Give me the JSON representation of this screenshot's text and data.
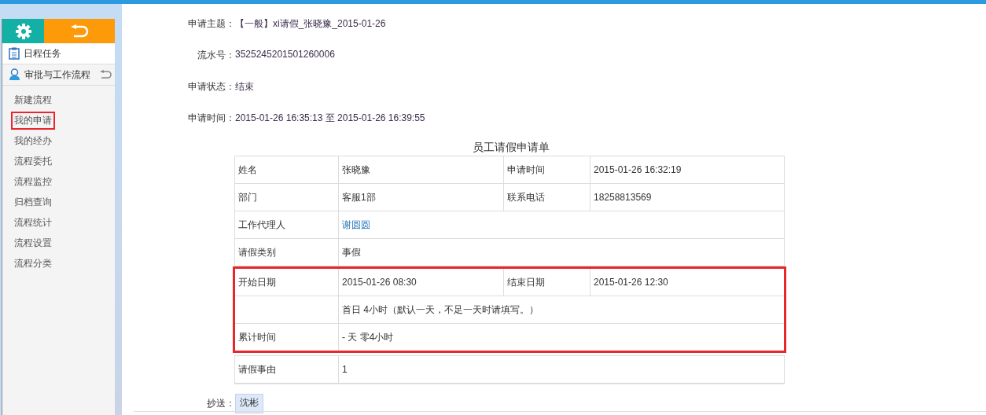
{
  "sidebar": {
    "menus": [
      {
        "label": "日程任务",
        "kind": "calendar"
      },
      {
        "label": "审批与工作流程",
        "kind": "workflow"
      }
    ],
    "items": [
      {
        "label": "新建流程",
        "selected": false
      },
      {
        "label": "我的申请",
        "selected": true
      },
      {
        "label": "我的经办",
        "selected": false
      },
      {
        "label": "流程委托",
        "selected": false
      },
      {
        "label": "流程监控",
        "selected": false
      },
      {
        "label": "归档查询",
        "selected": false
      },
      {
        "label": "流程统计",
        "selected": false
      },
      {
        "label": "流程设置",
        "selected": false
      },
      {
        "label": "流程分类",
        "selected": false
      }
    ]
  },
  "fields": [
    {
      "label": "申请主题：",
      "value": "【一般】xi请假_张晓豫_2015-01-26"
    },
    {
      "label": "流水号：",
      "value": "3525245201501260006"
    },
    {
      "label": "申请状态：",
      "value": "结束"
    },
    {
      "label": "申请时间：",
      "value": "2015-01-26 16:35:13 至 2015-01-26 16:39:55"
    }
  ],
  "form": {
    "title": "员工请假申请单",
    "sections": [
      {
        "highlighted": false,
        "rows": [
          {
            "cells": [
              {
                "text": "姓名"
              },
              {
                "text": "张晓豫"
              },
              {
                "text": "申请时间"
              },
              {
                "text": "2015-01-26 16:32:19"
              }
            ]
          },
          {
            "cells": [
              {
                "text": "部门"
              },
              {
                "text": "客服1部"
              },
              {
                "text": "联系电话"
              },
              {
                "text": "18258813569"
              }
            ]
          },
          {
            "cells": [
              {
                "text": "工作代理人"
              },
              {
                "text": "谢圆圆",
                "kind": "link"
              }
            ]
          },
          {
            "cells": [
              {
                "text": "请假类别"
              },
              {
                "text": "事假"
              }
            ]
          }
        ]
      },
      {
        "highlighted": true,
        "rows": [
          {
            "cells": [
              {
                "text": "开始日期"
              },
              {
                "text": "2015-01-26 08:30"
              },
              {
                "text": "结束日期"
              },
              {
                "text": "2015-01-26 12:30"
              }
            ]
          },
          {
            "cells": [
              {
                "text": ""
              },
              {
                "text": "首日 4小时（默认一天，不足一天时请填写。）"
              }
            ]
          },
          {
            "cells": [
              {
                "text": "累计时间"
              },
              {
                "text": "- 天 零4小时"
              }
            ]
          }
        ]
      },
      {
        "highlighted": false,
        "rows": [
          {
            "cells": [
              {
                "text": "请假事由"
              },
              {
                "text": "1"
              }
            ]
          }
        ]
      }
    ]
  },
  "cc": {
    "label": "抄送：",
    "names": [
      "沈彬"
    ]
  }
}
